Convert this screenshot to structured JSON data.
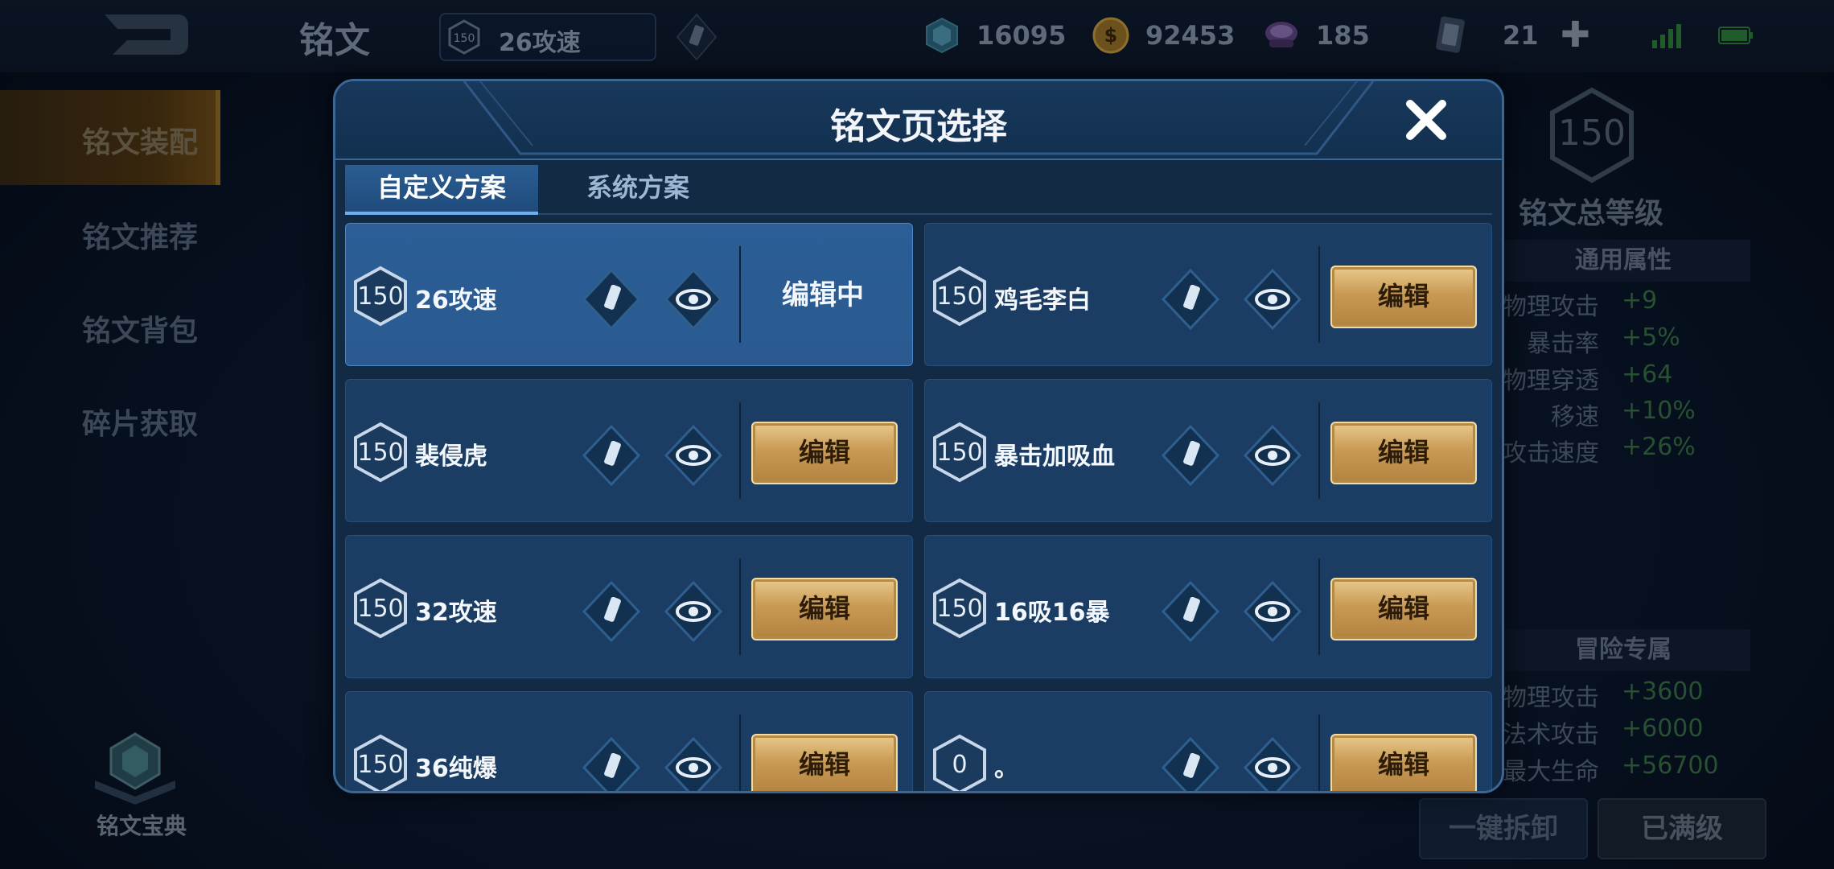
{
  "topbar": {
    "title": "铭文",
    "current_page": {
      "level": "150",
      "name": "26攻速"
    },
    "resources": [
      {
        "icon": "diamond-icon",
        "value": "16095"
      },
      {
        "icon": "gold-coin-icon",
        "value": "92453"
      },
      {
        "icon": "crystal-icon",
        "value": "185"
      },
      {
        "icon": "card-icon",
        "value": "21"
      }
    ],
    "plus": "✚"
  },
  "leftnav": {
    "items": [
      {
        "label": "铭文装配",
        "active": true
      },
      {
        "label": "铭文推荐"
      },
      {
        "label": "铭文背包"
      },
      {
        "label": "碎片获取"
      }
    ],
    "codex_label": "铭文宝典"
  },
  "right_panel": {
    "total_level": "150",
    "total_level_label": "铭文总等级",
    "general_section": "通用属性",
    "general_stats": [
      {
        "k": "物理攻击",
        "v": "+9"
      },
      {
        "k": "暴击率",
        "v": "+5%"
      },
      {
        "k": "物理穿透",
        "v": "+64"
      },
      {
        "k": "移速",
        "v": "+10%"
      },
      {
        "k": "攻击速度",
        "v": "+26%"
      }
    ],
    "adventure_section": "冒险专属",
    "adventure_stats": [
      {
        "k": "物理攻击",
        "v": "+3600"
      },
      {
        "k": "法术攻击",
        "v": "+6000"
      },
      {
        "k": "最大生命",
        "v": "+56700"
      }
    ],
    "btn_unequip": "一键拆卸",
    "btn_maxed": "已满级"
  },
  "modal": {
    "title": "铭文页选择",
    "tabs": [
      "自定义方案",
      "系统方案"
    ],
    "edit_label": "编辑",
    "editing_label": "编辑中",
    "pages": [
      {
        "level": "150",
        "name": "26攻速",
        "state": "编辑中"
      },
      {
        "level": "150",
        "name": "鸡毛李白",
        "state": "编辑"
      },
      {
        "level": "150",
        "name": "裴侵虎",
        "state": "编辑"
      },
      {
        "level": "150",
        "name": "暴击加吸血",
        "state": "编辑"
      },
      {
        "level": "150",
        "name": "32攻速",
        "state": "编辑"
      },
      {
        "level": "150",
        "name": "16吸16暴",
        "state": "编辑"
      },
      {
        "level": "150",
        "name": "36纯爆",
        "state": "编辑"
      },
      {
        "level": "0",
        "name": "。",
        "state": "编辑"
      }
    ]
  },
  "colors": {
    "accent_gold": "#c99a54",
    "tab_active": "#2a5d93",
    "stat_green": "#3c7a45"
  }
}
